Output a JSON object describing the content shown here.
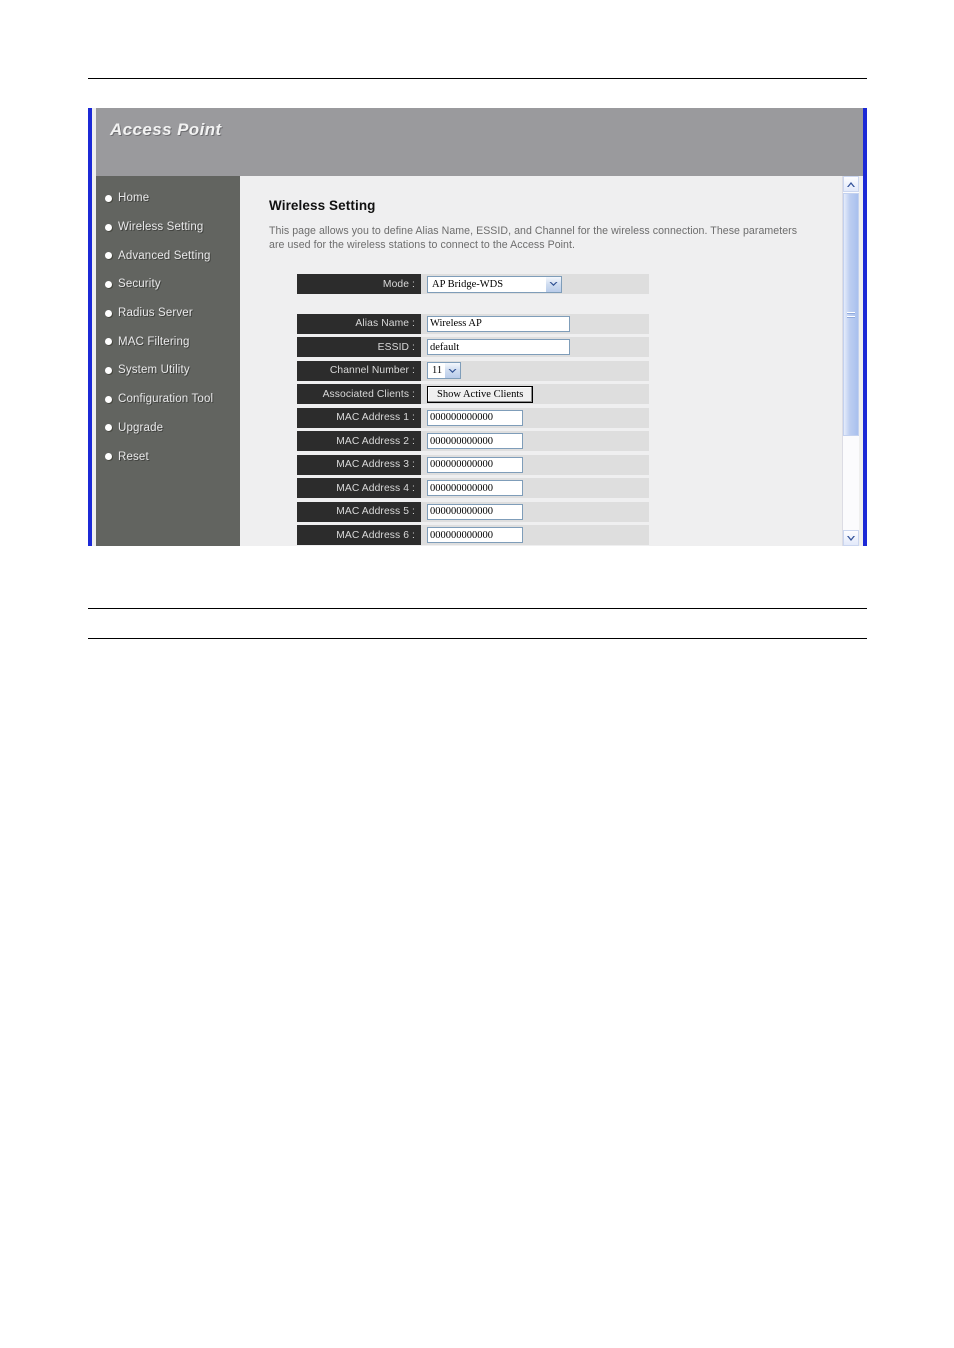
{
  "app": {
    "banner_title": "Access Point"
  },
  "sidebar": {
    "items": [
      {
        "label": "Home",
        "name": "home"
      },
      {
        "label": "Wireless Setting",
        "name": "wireless-setting"
      },
      {
        "label": "Advanced Setting",
        "name": "advanced-setting"
      },
      {
        "label": "Security",
        "name": "security"
      },
      {
        "label": "Radius Server",
        "name": "radius-server"
      },
      {
        "label": "MAC Filtering",
        "name": "mac-filtering"
      },
      {
        "label": "System Utility",
        "name": "system-utility"
      },
      {
        "label": "Configuration Tool",
        "name": "configuration-tool"
      },
      {
        "label": "Upgrade",
        "name": "upgrade"
      },
      {
        "label": "Reset",
        "name": "reset"
      }
    ]
  },
  "content": {
    "title": "Wireless Setting",
    "description": "This page allows you to define Alias Name, ESSID, and Channel for the wireless connection. These parameters are used for the wireless stations to connect to the Access Point.",
    "fields": {
      "mode": {
        "label": "Mode :",
        "value": "AP Bridge-WDS"
      },
      "alias_name": {
        "label": "Alias Name :",
        "value": "Wireless AP"
      },
      "essid": {
        "label": "ESSID :",
        "value": "default"
      },
      "channel_number": {
        "label": "Channel Number :",
        "value": "11"
      },
      "associated_clients": {
        "label": "Associated Clients :",
        "button_label": "Show Active Clients"
      },
      "mac_addresses": [
        {
          "label": "MAC Address 1 :",
          "value": "000000000000"
        },
        {
          "label": "MAC Address 2 :",
          "value": "000000000000"
        },
        {
          "label": "MAC Address 3 :",
          "value": "000000000000"
        },
        {
          "label": "MAC Address 4 :",
          "value": "000000000000"
        },
        {
          "label": "MAC Address 5 :",
          "value": "000000000000"
        },
        {
          "label": "MAC Address 6 :",
          "value": "000000000000"
        }
      ]
    }
  },
  "colors": {
    "frame_border": "#1c29d6",
    "banner_bg": "#9a9a9d",
    "sidebar_bg": "#626460",
    "content_bg": "#efeff0",
    "label_bg": "#2c2c2c",
    "row_bg": "#dedede",
    "scrollbar_thumb": "#a9c0ee"
  }
}
